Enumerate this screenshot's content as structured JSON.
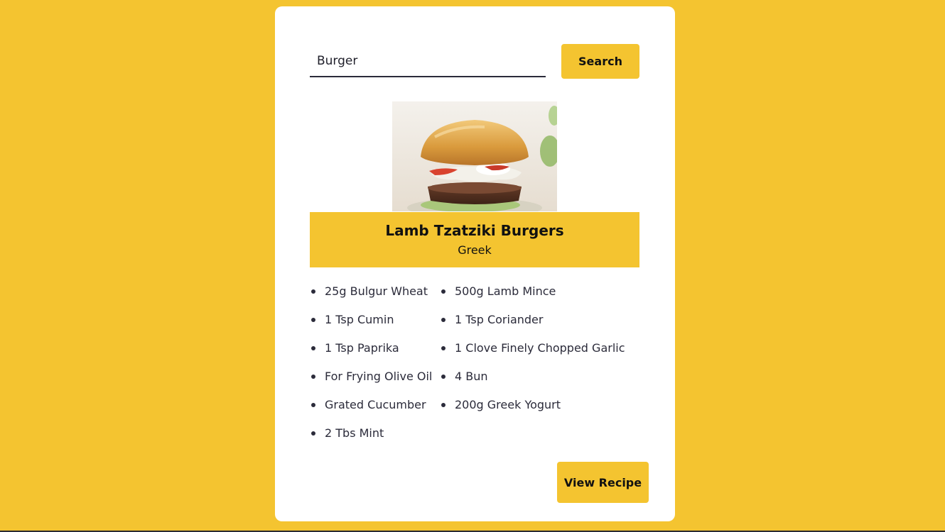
{
  "search": {
    "value": "Burger",
    "button_label": "Search"
  },
  "meal": {
    "image_alt": "burger-photo",
    "title": "Lamb Tzatziki Burgers",
    "area": "Greek",
    "ingredients": [
      "25g Bulgur Wheat",
      "500g Lamb Mince",
      "1 Tsp Cumin",
      "1 Tsp Coriander",
      "1 Tsp Paprika",
      "1 Clove Finely Chopped Garlic",
      "For Frying Olive Oil",
      "4 Bun",
      "Grated Cucumber",
      "200g Greek Yogurt",
      "2 Tbs Mint"
    ],
    "view_button_label": "View Recipe"
  },
  "colors": {
    "background": "#f4c430",
    "card": "#ffffff",
    "accent": "#f4c430",
    "text": "#2b2b3a"
  }
}
